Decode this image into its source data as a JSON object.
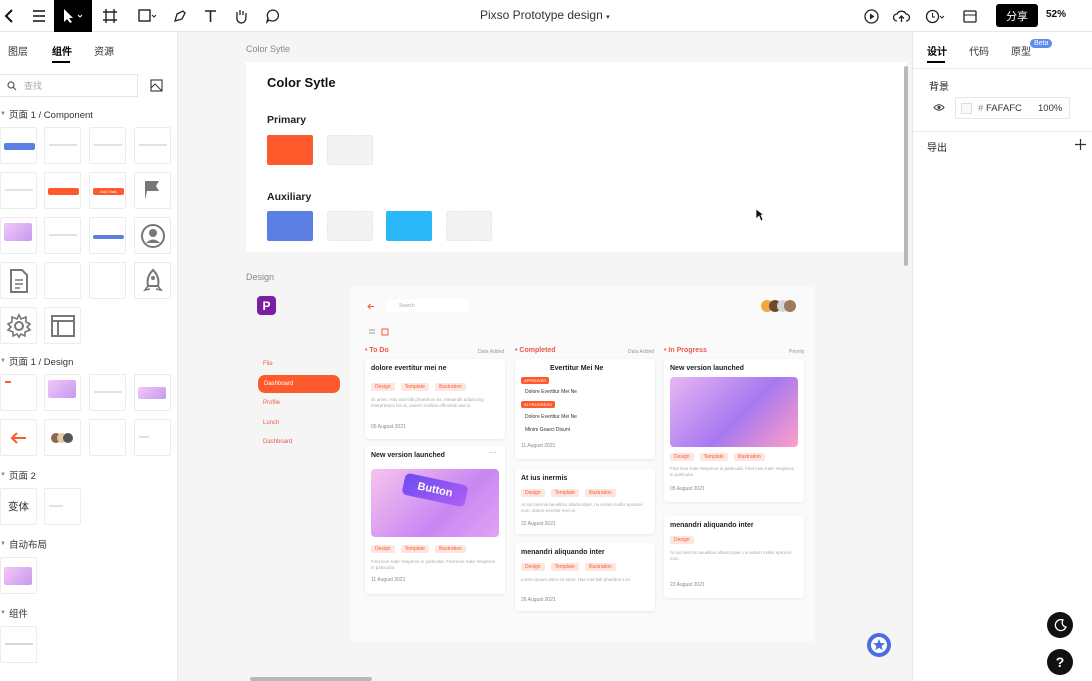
{
  "app": {
    "title": "Pixso Prototype design",
    "share_label": "分享",
    "zoom": "52%"
  },
  "left_panel": {
    "tabs": [
      "图层",
      "组件",
      "资源"
    ],
    "active_tab": "组件",
    "search_placeholder": "查找",
    "sections": [
      {
        "label": "页面 1 / Component"
      },
      {
        "label": "页面 1 / Design"
      },
      {
        "label": "页面 2"
      },
      {
        "label": "自动布局"
      },
      {
        "label": "组件"
      }
    ],
    "variant_label": "变体",
    "thumb_labels": {
      "add_task": "Add Task",
      "dashboard": "Dashboard"
    }
  },
  "canvas": {
    "color_frame_label": "Color Sytle",
    "design_frame_label": "Design",
    "color_style": {
      "title": "Color Sytle",
      "primary_label": "Primary",
      "auxiliary_label": "Auxiliary",
      "primary_colors": [
        "#FF5A2C"
      ],
      "auxiliary_colors": [
        "#5B7FE3",
        "#2BB8F8"
      ]
    },
    "design": {
      "search_placeholder": "Search",
      "nav": [
        "File",
        "Dashboard",
        "Profile",
        "Lunch",
        "Dashboard"
      ],
      "nav_active_index": 1,
      "columns": [
        {
          "title": "To Do",
          "right": "Date Added"
        },
        {
          "title": "Completed",
          "right": "Data Added"
        },
        {
          "title": "In Progress",
          "right": "Priority"
        }
      ],
      "cards": {
        "todo_1": {
          "title": "dolore evertitur mei ne",
          "tags": [
            "Design",
            "Template",
            "Illustration"
          ],
          "desc": "sit amet. Has tota falli phaedrum ex, meaendit adipiscing interpretaris his id, unierm mollitia efficiendi sed in.",
          "date": "05 August 2021"
        },
        "todo_2": {
          "title": "New version launched",
          "tags": [
            "Design",
            "Template",
            "Illustration"
          ],
          "desc": "Find love Kate Yesperus in particular. Find love Kate Yesperus in particular.",
          "date": "11 August 2021",
          "button_text": "Button"
        },
        "done_1": {
          "title": "Evertitur Mei Ne",
          "badge1": "APPROVED",
          "badge2": "IN PROGRESS",
          "items": [
            "Dolore Evertitur Mei Ne",
            "Dolore Evertitur Mei Ne",
            "Minim Graeci Dixunt"
          ],
          "date": "11 August 2021"
        },
        "done_2": {
          "title": "At ius inermis",
          "tags": [
            "Design",
            "Template",
            "Illustration"
          ],
          "desc": "At ius inermis aeuelitus ullamcorper, no eolum mollis epicurei cum, dolore everititr mei ne.",
          "date": "22 August 2021"
        },
        "done_3": {
          "title": "menandri aliquando inter",
          "tags": [
            "Design",
            "Template",
            "Illustration"
          ],
          "desc": "Lorem ipsum dolor sit amet. Has tota falli phaedrum ex.",
          "date": "26 August 2021"
        },
        "prog_1": {
          "title": "New version launched",
          "tags": [
            "Design",
            "Template",
            "Illustration"
          ],
          "desc": "Find love Kate Yesperus in particular. Find love Kate Yesperus in particular.",
          "date": "05 August 2021"
        },
        "prog_2": {
          "title": "menandri aliquando inter",
          "tags": [
            "Design"
          ],
          "desc": "At ius inermis aeuelitus ullamcorper, no eolum mollis epicurei cum.",
          "date": "22 August 2021"
        }
      }
    }
  },
  "right_panel": {
    "tabs": [
      "设计",
      "代码",
      "原型"
    ],
    "active_tab": "设计",
    "beta_label": "Beta",
    "background_label": "背景",
    "hash": "#",
    "bg_color": "FAFAFC",
    "bg_opacity": "100%",
    "export_label": "导出",
    "help_label": "?"
  }
}
